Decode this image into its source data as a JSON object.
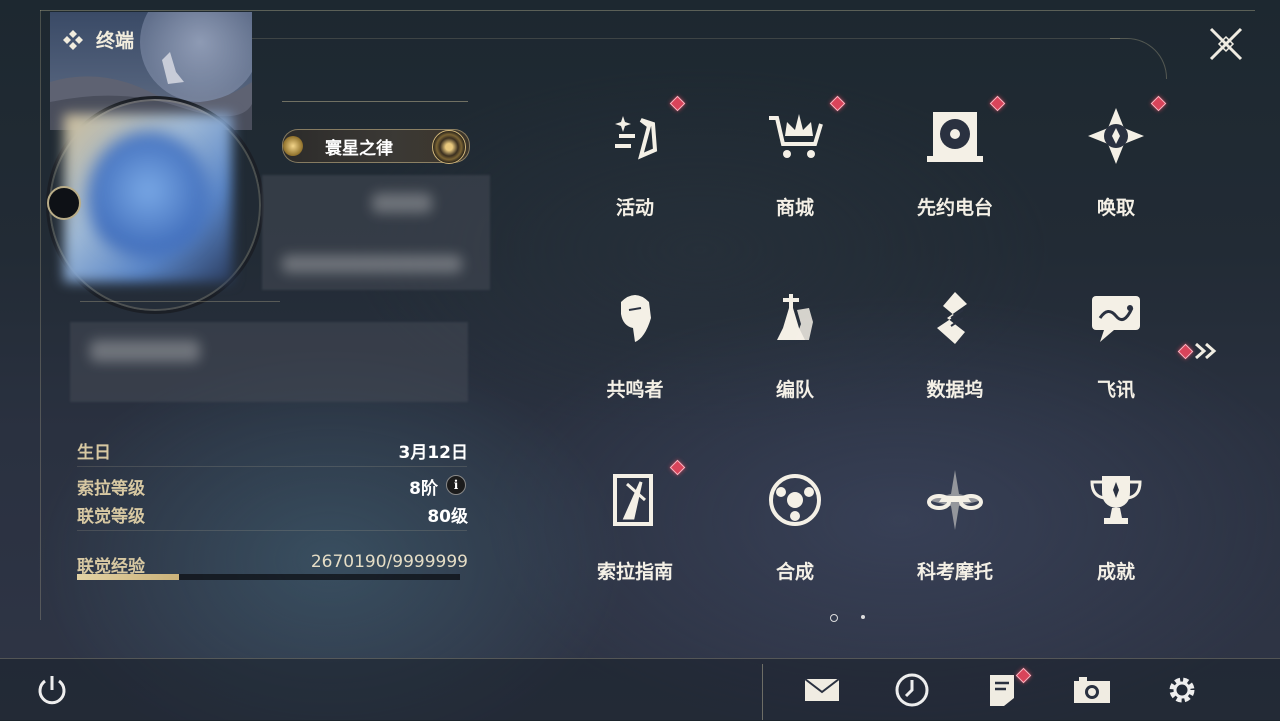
{
  "header": {
    "title": "终端",
    "close_label": "close"
  },
  "profile": {
    "title_badge": "寰星之律",
    "stats": [
      {
        "label": "生日",
        "value": "3月12日"
      },
      {
        "label": "索拉等级",
        "value": "8阶"
      },
      {
        "label": "联觉等级",
        "value": "80级"
      }
    ],
    "xp": {
      "label": "联觉经验",
      "value": "2670190/9999999",
      "progress": 0.267
    }
  },
  "menu": {
    "items": [
      {
        "label": "活动",
        "icon": "activity-icon",
        "badge": true
      },
      {
        "label": "商城",
        "icon": "shop-crown-cart-icon",
        "badge": true
      },
      {
        "label": "先约电台",
        "icon": "radio-record-icon",
        "badge": true
      },
      {
        "label": "唤取",
        "icon": "summon-compass-icon",
        "badge": true
      },
      {
        "label": "共鸣者",
        "icon": "resonator-portrait-icon",
        "badge": false
      },
      {
        "label": "编队",
        "icon": "team-chess-icon",
        "badge": false
      },
      {
        "label": "数据坞",
        "icon": "data-dock-icon",
        "badge": false
      },
      {
        "label": "飞讯",
        "icon": "message-chat-icon",
        "badge": false
      },
      {
        "label": "索拉指南",
        "icon": "guidebook-icon",
        "badge": true
      },
      {
        "label": "合成",
        "icon": "synthesis-icon",
        "badge": false
      },
      {
        "label": "科考摩托",
        "icon": "motorcycle-icon",
        "badge": false
      },
      {
        "label": "成就",
        "icon": "trophy-icon",
        "badge": false
      }
    ],
    "pagination": {
      "pages": 2,
      "current": 1
    }
  },
  "bottom": {
    "buttons": [
      "power-icon",
      "mail-icon",
      "clock-icon",
      "notice-icon",
      "camera-icon",
      "settings-gear-icon"
    ]
  },
  "colors": {
    "accent_gold": "#d7c8a2",
    "badge_red": "#d9445a",
    "text_light": "#f4f0e6"
  }
}
